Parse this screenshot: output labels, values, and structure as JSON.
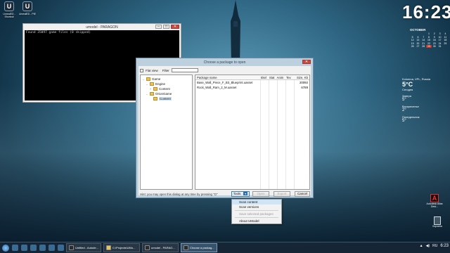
{
  "desktop": {
    "icons": [
      {
        "label": "UnrealED - Shortcut",
        "glyph": "U"
      },
      {
        "label": "UnrealED - PIE",
        "glyph": "U"
      }
    ]
  },
  "console": {
    "title": "umodel - PARAGON",
    "output": "Found 35097 game files (0 skipped)",
    "minimize": "–",
    "maximize": "□",
    "close": "✕"
  },
  "dialog": {
    "title": "Choose a package to open",
    "close": "✕",
    "flat_view_label": "Flat view",
    "filter_label": "Filter",
    "tree": [
      {
        "label": "Game",
        "depth": 0,
        "toggle": "–"
      },
      {
        "label": "Engine",
        "depth": 1,
        "toggle": "–"
      },
      {
        "label": "Content",
        "depth": 2,
        "toggle": "+"
      },
      {
        "label": "OrionGame",
        "depth": 1,
        "toggle": "–"
      },
      {
        "label": "Content",
        "depth": 2,
        "toggle": "",
        "selected": true
      }
    ],
    "columns": {
      "name": "Package name",
      "skel": "Skel",
      "stat": "Stat",
      "anim": "Anim",
      "tex": "Tex",
      "size": "Size, Kb"
    },
    "rows": [
      {
        "name": "Base_Wall_Piece_F_B3_Blueprint.uasset",
        "size": "20092"
      },
      {
        "name": "Rock_Wall_Ram_2_M.uasset",
        "size": "6789"
      }
    ],
    "hint": "Hint: you may open this dialog at any time by pressing \"O\"",
    "buttons": {
      "tools": "Tools",
      "open": "Open",
      "export": "Export",
      "cancel": "Cancel"
    },
    "tools_arrow": "▾"
  },
  "tools_menu": {
    "items": [
      "Scan content",
      "Scan versions",
      "Save selected packages",
      "About UModel"
    ]
  },
  "clock": {
    "time": "16:23"
  },
  "calendar": {
    "month": "OCTOBER",
    "days": [
      "",
      "",
      "",
      "1",
      "2",
      "3",
      "4",
      "5",
      "6",
      "7",
      "8",
      "9",
      "10",
      "11",
      "12",
      "13",
      "14",
      "15",
      "16",
      "17",
      "18",
      "19",
      "20",
      "21",
      "22",
      "23",
      "24",
      "25",
      "26",
      "27",
      "28",
      "29",
      "30",
      "31",
      "",
      ""
    ],
    "today": "29"
  },
  "weather": {
    "city": "Kolomna, VPL, Russia",
    "temp": "5°C",
    "today_label": "Сегодня",
    "forecast": [
      {
        "day": "Завтра",
        "temp": "5°"
      },
      {
        "day": "Воскресенье",
        "temp": "2°"
      },
      {
        "day": "Понедельник",
        "temp": "5°"
      }
    ]
  },
  "side_icons": {
    "autodesk_label": "Autodesk Alias Desi...",
    "bin_label": "Корзина"
  },
  "taskbar": {
    "tasks": [
      {
        "label": "Untitled - Autode...",
        "active": false
      },
      {
        "label": "C:\\Projects\\UMo...",
        "active": false
      },
      {
        "label": "umodel - PARAG...",
        "active": false
      },
      {
        "label": "Choose a packag...",
        "active": true
      }
    ],
    "tray_lang": "RU",
    "tray_time": "6:23"
  }
}
